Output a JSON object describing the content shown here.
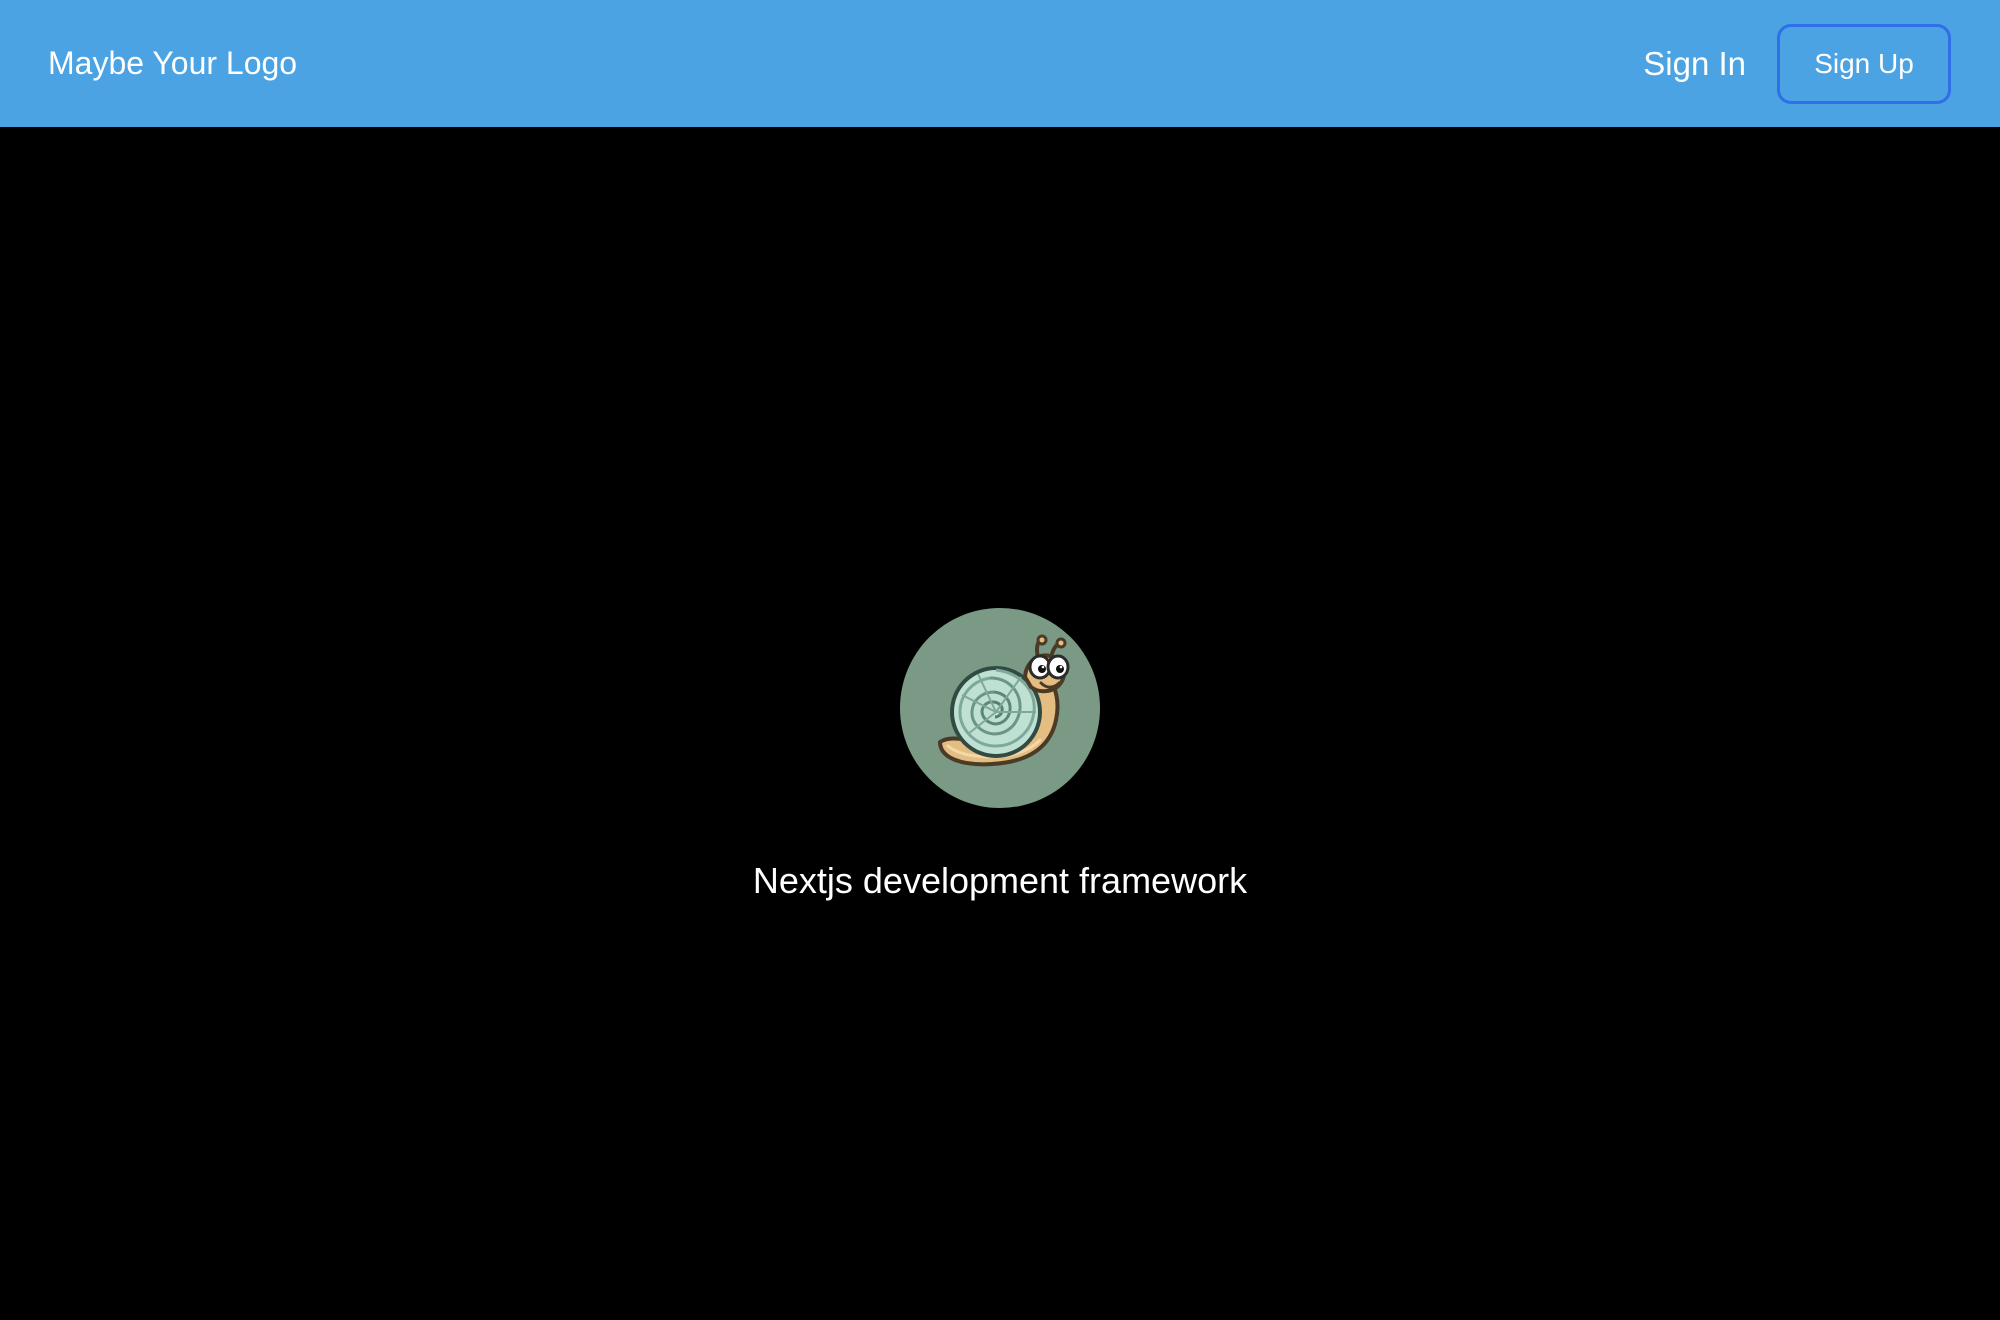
{
  "header": {
    "logo_text": "Maybe Your Logo",
    "signin_label": "Sign In",
    "signup_label": "Sign Up"
  },
  "hero": {
    "image_icon": "snail-icon",
    "text": "Nextjs development framework"
  },
  "colors": {
    "navbar_background": "#4ba3e3",
    "page_background": "#000000",
    "signup_border": "#2f6fe8",
    "hero_circle": "#7a9a86"
  }
}
